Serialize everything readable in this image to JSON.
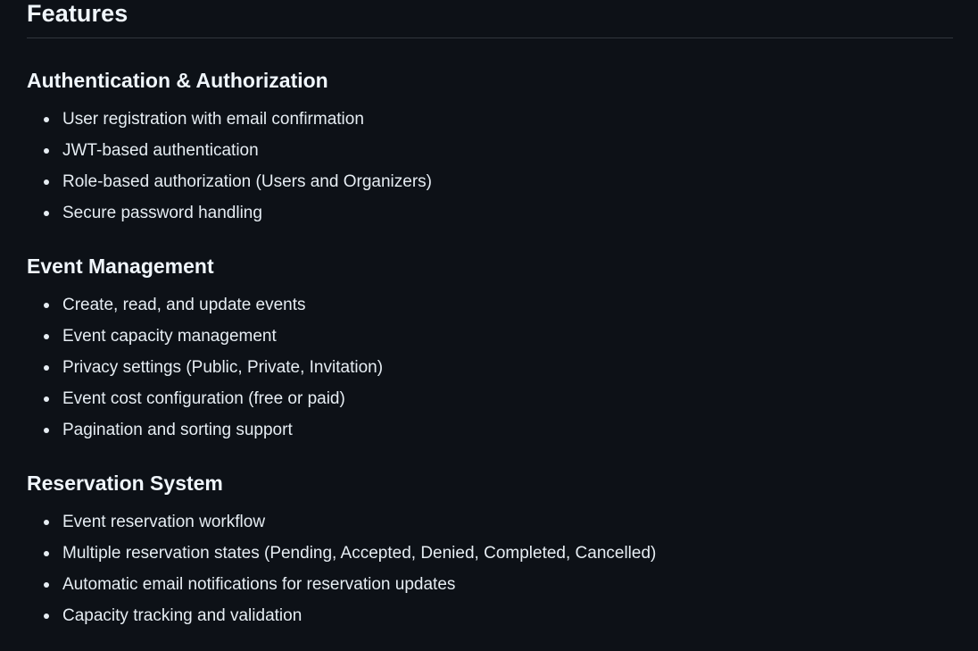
{
  "page": {
    "title": "Features"
  },
  "sections": [
    {
      "heading": "Authentication & Authorization",
      "items": [
        "User registration with email confirmation",
        "JWT-based authentication",
        "Role-based authorization (Users and Organizers)",
        "Secure password handling"
      ]
    },
    {
      "heading": "Event Management",
      "items": [
        "Create, read, and update events",
        "Event capacity management",
        "Privacy settings (Public, Private, Invitation)",
        "Event cost configuration (free or paid)",
        "Pagination and sorting support"
      ]
    },
    {
      "heading": "Reservation System",
      "items": [
        "Event reservation workflow",
        "Multiple reservation states (Pending, Accepted, Denied, Completed, Cancelled)",
        "Automatic email notifications for reservation updates",
        "Capacity tracking and validation"
      ]
    }
  ],
  "colors": {
    "background": "#0d1117",
    "text": "#e6edf3",
    "divider": "#30363d"
  }
}
